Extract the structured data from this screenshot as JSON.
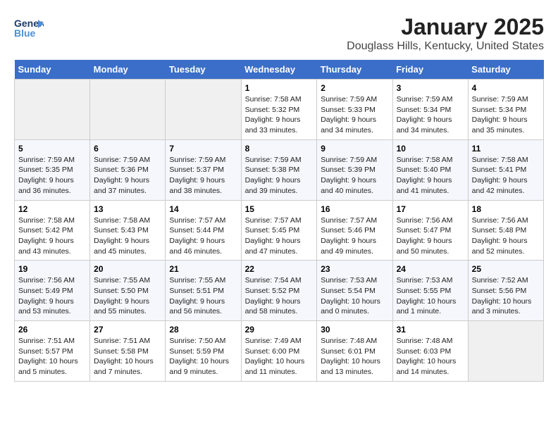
{
  "header": {
    "logo_line1": "General",
    "logo_line2": "Blue",
    "month": "January 2025",
    "location": "Douglass Hills, Kentucky, United States"
  },
  "weekdays": [
    "Sunday",
    "Monday",
    "Tuesday",
    "Wednesday",
    "Thursday",
    "Friday",
    "Saturday"
  ],
  "weeks": [
    [
      {
        "day": "",
        "detail": ""
      },
      {
        "day": "",
        "detail": ""
      },
      {
        "day": "",
        "detail": ""
      },
      {
        "day": "1",
        "detail": "Sunrise: 7:58 AM\nSunset: 5:32 PM\nDaylight: 9 hours\nand 33 minutes."
      },
      {
        "day": "2",
        "detail": "Sunrise: 7:59 AM\nSunset: 5:33 PM\nDaylight: 9 hours\nand 34 minutes."
      },
      {
        "day": "3",
        "detail": "Sunrise: 7:59 AM\nSunset: 5:34 PM\nDaylight: 9 hours\nand 34 minutes."
      },
      {
        "day": "4",
        "detail": "Sunrise: 7:59 AM\nSunset: 5:34 PM\nDaylight: 9 hours\nand 35 minutes."
      }
    ],
    [
      {
        "day": "5",
        "detail": "Sunrise: 7:59 AM\nSunset: 5:35 PM\nDaylight: 9 hours\nand 36 minutes."
      },
      {
        "day": "6",
        "detail": "Sunrise: 7:59 AM\nSunset: 5:36 PM\nDaylight: 9 hours\nand 37 minutes."
      },
      {
        "day": "7",
        "detail": "Sunrise: 7:59 AM\nSunset: 5:37 PM\nDaylight: 9 hours\nand 38 minutes."
      },
      {
        "day": "8",
        "detail": "Sunrise: 7:59 AM\nSunset: 5:38 PM\nDaylight: 9 hours\nand 39 minutes."
      },
      {
        "day": "9",
        "detail": "Sunrise: 7:59 AM\nSunset: 5:39 PM\nDaylight: 9 hours\nand 40 minutes."
      },
      {
        "day": "10",
        "detail": "Sunrise: 7:58 AM\nSunset: 5:40 PM\nDaylight: 9 hours\nand 41 minutes."
      },
      {
        "day": "11",
        "detail": "Sunrise: 7:58 AM\nSunset: 5:41 PM\nDaylight: 9 hours\nand 42 minutes."
      }
    ],
    [
      {
        "day": "12",
        "detail": "Sunrise: 7:58 AM\nSunset: 5:42 PM\nDaylight: 9 hours\nand 43 minutes."
      },
      {
        "day": "13",
        "detail": "Sunrise: 7:58 AM\nSunset: 5:43 PM\nDaylight: 9 hours\nand 45 minutes."
      },
      {
        "day": "14",
        "detail": "Sunrise: 7:57 AM\nSunset: 5:44 PM\nDaylight: 9 hours\nand 46 minutes."
      },
      {
        "day": "15",
        "detail": "Sunrise: 7:57 AM\nSunset: 5:45 PM\nDaylight: 9 hours\nand 47 minutes."
      },
      {
        "day": "16",
        "detail": "Sunrise: 7:57 AM\nSunset: 5:46 PM\nDaylight: 9 hours\nand 49 minutes."
      },
      {
        "day": "17",
        "detail": "Sunrise: 7:56 AM\nSunset: 5:47 PM\nDaylight: 9 hours\nand 50 minutes."
      },
      {
        "day": "18",
        "detail": "Sunrise: 7:56 AM\nSunset: 5:48 PM\nDaylight: 9 hours\nand 52 minutes."
      }
    ],
    [
      {
        "day": "19",
        "detail": "Sunrise: 7:56 AM\nSunset: 5:49 PM\nDaylight: 9 hours\nand 53 minutes."
      },
      {
        "day": "20",
        "detail": "Sunrise: 7:55 AM\nSunset: 5:50 PM\nDaylight: 9 hours\nand 55 minutes."
      },
      {
        "day": "21",
        "detail": "Sunrise: 7:55 AM\nSunset: 5:51 PM\nDaylight: 9 hours\nand 56 minutes."
      },
      {
        "day": "22",
        "detail": "Sunrise: 7:54 AM\nSunset: 5:52 PM\nDaylight: 9 hours\nand 58 minutes."
      },
      {
        "day": "23",
        "detail": "Sunrise: 7:53 AM\nSunset: 5:54 PM\nDaylight: 10 hours\nand 0 minutes."
      },
      {
        "day": "24",
        "detail": "Sunrise: 7:53 AM\nSunset: 5:55 PM\nDaylight: 10 hours\nand 1 minute."
      },
      {
        "day": "25",
        "detail": "Sunrise: 7:52 AM\nSunset: 5:56 PM\nDaylight: 10 hours\nand 3 minutes."
      }
    ],
    [
      {
        "day": "26",
        "detail": "Sunrise: 7:51 AM\nSunset: 5:57 PM\nDaylight: 10 hours\nand 5 minutes."
      },
      {
        "day": "27",
        "detail": "Sunrise: 7:51 AM\nSunset: 5:58 PM\nDaylight: 10 hours\nand 7 minutes."
      },
      {
        "day": "28",
        "detail": "Sunrise: 7:50 AM\nSunset: 5:59 PM\nDaylight: 10 hours\nand 9 minutes."
      },
      {
        "day": "29",
        "detail": "Sunrise: 7:49 AM\nSunset: 6:00 PM\nDaylight: 10 hours\nand 11 minutes."
      },
      {
        "day": "30",
        "detail": "Sunrise: 7:48 AM\nSunset: 6:01 PM\nDaylight: 10 hours\nand 13 minutes."
      },
      {
        "day": "31",
        "detail": "Sunrise: 7:48 AM\nSunset: 6:03 PM\nDaylight: 10 hours\nand 14 minutes."
      },
      {
        "day": "",
        "detail": ""
      }
    ]
  ]
}
